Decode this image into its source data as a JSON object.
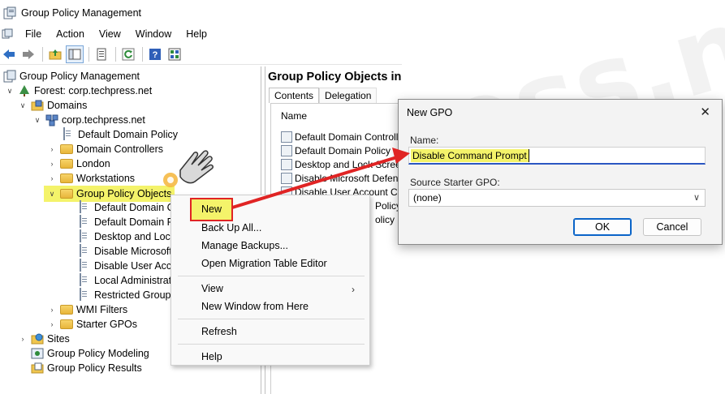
{
  "window": {
    "title": "Group Policy Management"
  },
  "menubar": {
    "items": [
      "File",
      "Action",
      "View",
      "Window",
      "Help"
    ]
  },
  "toolbar": {
    "icons": [
      "back-icon",
      "forward-icon",
      "up-folder-icon",
      "show-hide-tree-icon",
      "properties-icon",
      "refresh-icon",
      "help-icon",
      "view-icon"
    ]
  },
  "tree": {
    "root": "Group Policy Management",
    "forest": "Forest: corp.techpress.net",
    "domains": "Domains",
    "domain": "corp.techpress.net",
    "default_domain_policy": "Default Domain Policy",
    "domain_controllers": "Domain Controllers",
    "london": "London",
    "workstations": "Workstations",
    "gpo_container": "Group Policy Objects",
    "gpos": [
      "Default Domain C",
      "Default Domain P",
      "Desktop and Lock",
      "Disable Microsoft",
      "Disable User Acco",
      "Local Administrat",
      "Restricted Groups"
    ],
    "wmi_filters": "WMI Filters",
    "starter_gpos": "Starter GPOs",
    "sites": "Sites",
    "modeling": "Group Policy Modeling",
    "results": "Group Policy Results"
  },
  "right_pane": {
    "title": "Group Policy Objects in",
    "tabs": [
      "Contents",
      "Delegation"
    ],
    "column_name": "Name",
    "rows": [
      "Default Domain Controllers",
      "Default Domain Policy",
      "Desktop and Lock Screen",
      "Disable Microsoft Defender",
      "Disable User Account Contr",
      "Policy",
      "olicy"
    ]
  },
  "context_menu": {
    "new": "New",
    "backup_all": "Back Up All...",
    "manage_backups": "Manage Backups...",
    "open_migration": "Open Migration Table Editor",
    "view": "View",
    "new_window": "New Window from Here",
    "refresh": "Refresh",
    "help": "Help"
  },
  "dialog": {
    "title": "New GPO",
    "name_label": "Name:",
    "name_value": "Disable Command Prompt",
    "starter_label": "Source Starter GPO:",
    "starter_value": "(none)",
    "ok": "OK",
    "cancel": "Cancel"
  },
  "watermark": "TechPress.net",
  "colors": {
    "highlight": "#f4f36a",
    "arrow": "#e02424",
    "accent": "#2b57c2"
  }
}
